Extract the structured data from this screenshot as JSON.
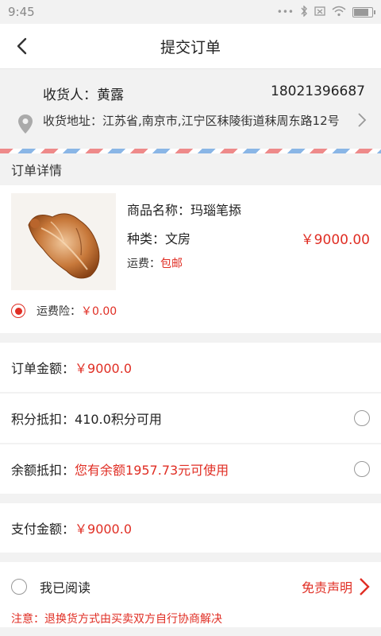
{
  "status_bar": {
    "time": "9:45",
    "battery_level": 0.9
  },
  "nav": {
    "title": "提交订单",
    "back_icon": "chevron-left-icon"
  },
  "address": {
    "receiver_label": "收货人：黄露",
    "phone": "18021396687",
    "address_line": "收货地址：江苏省,南京市,江宁区秣陵街道秣周东路12号"
  },
  "order_details": {
    "section_title": "订单详情",
    "product_name": "商品名称：玛瑙笔掭",
    "category": "种类：文房",
    "price": "￥9000.00",
    "shipping_label": "运费：",
    "shipping_value": "包邮",
    "insurance_label": "运费险：",
    "insurance_value": "￥0.00"
  },
  "summary": {
    "order_amount_label": "订单金额：",
    "order_amount_value": "￥9000.0",
    "points_label": "积分抵扣：",
    "points_text": "410.0积分可用",
    "balance_label": "余额抵扣：",
    "balance_text": "您有余额1957.73元可使用",
    "pay_amount_label": "支付金额：",
    "pay_amount_value": "￥9000.0"
  },
  "agreement": {
    "read_label": "我已阅读",
    "disclaimer": "免责声明",
    "note": "注意：退换货方式由买卖双方自行协商解决"
  },
  "colors": {
    "accent": "#e02e24"
  }
}
